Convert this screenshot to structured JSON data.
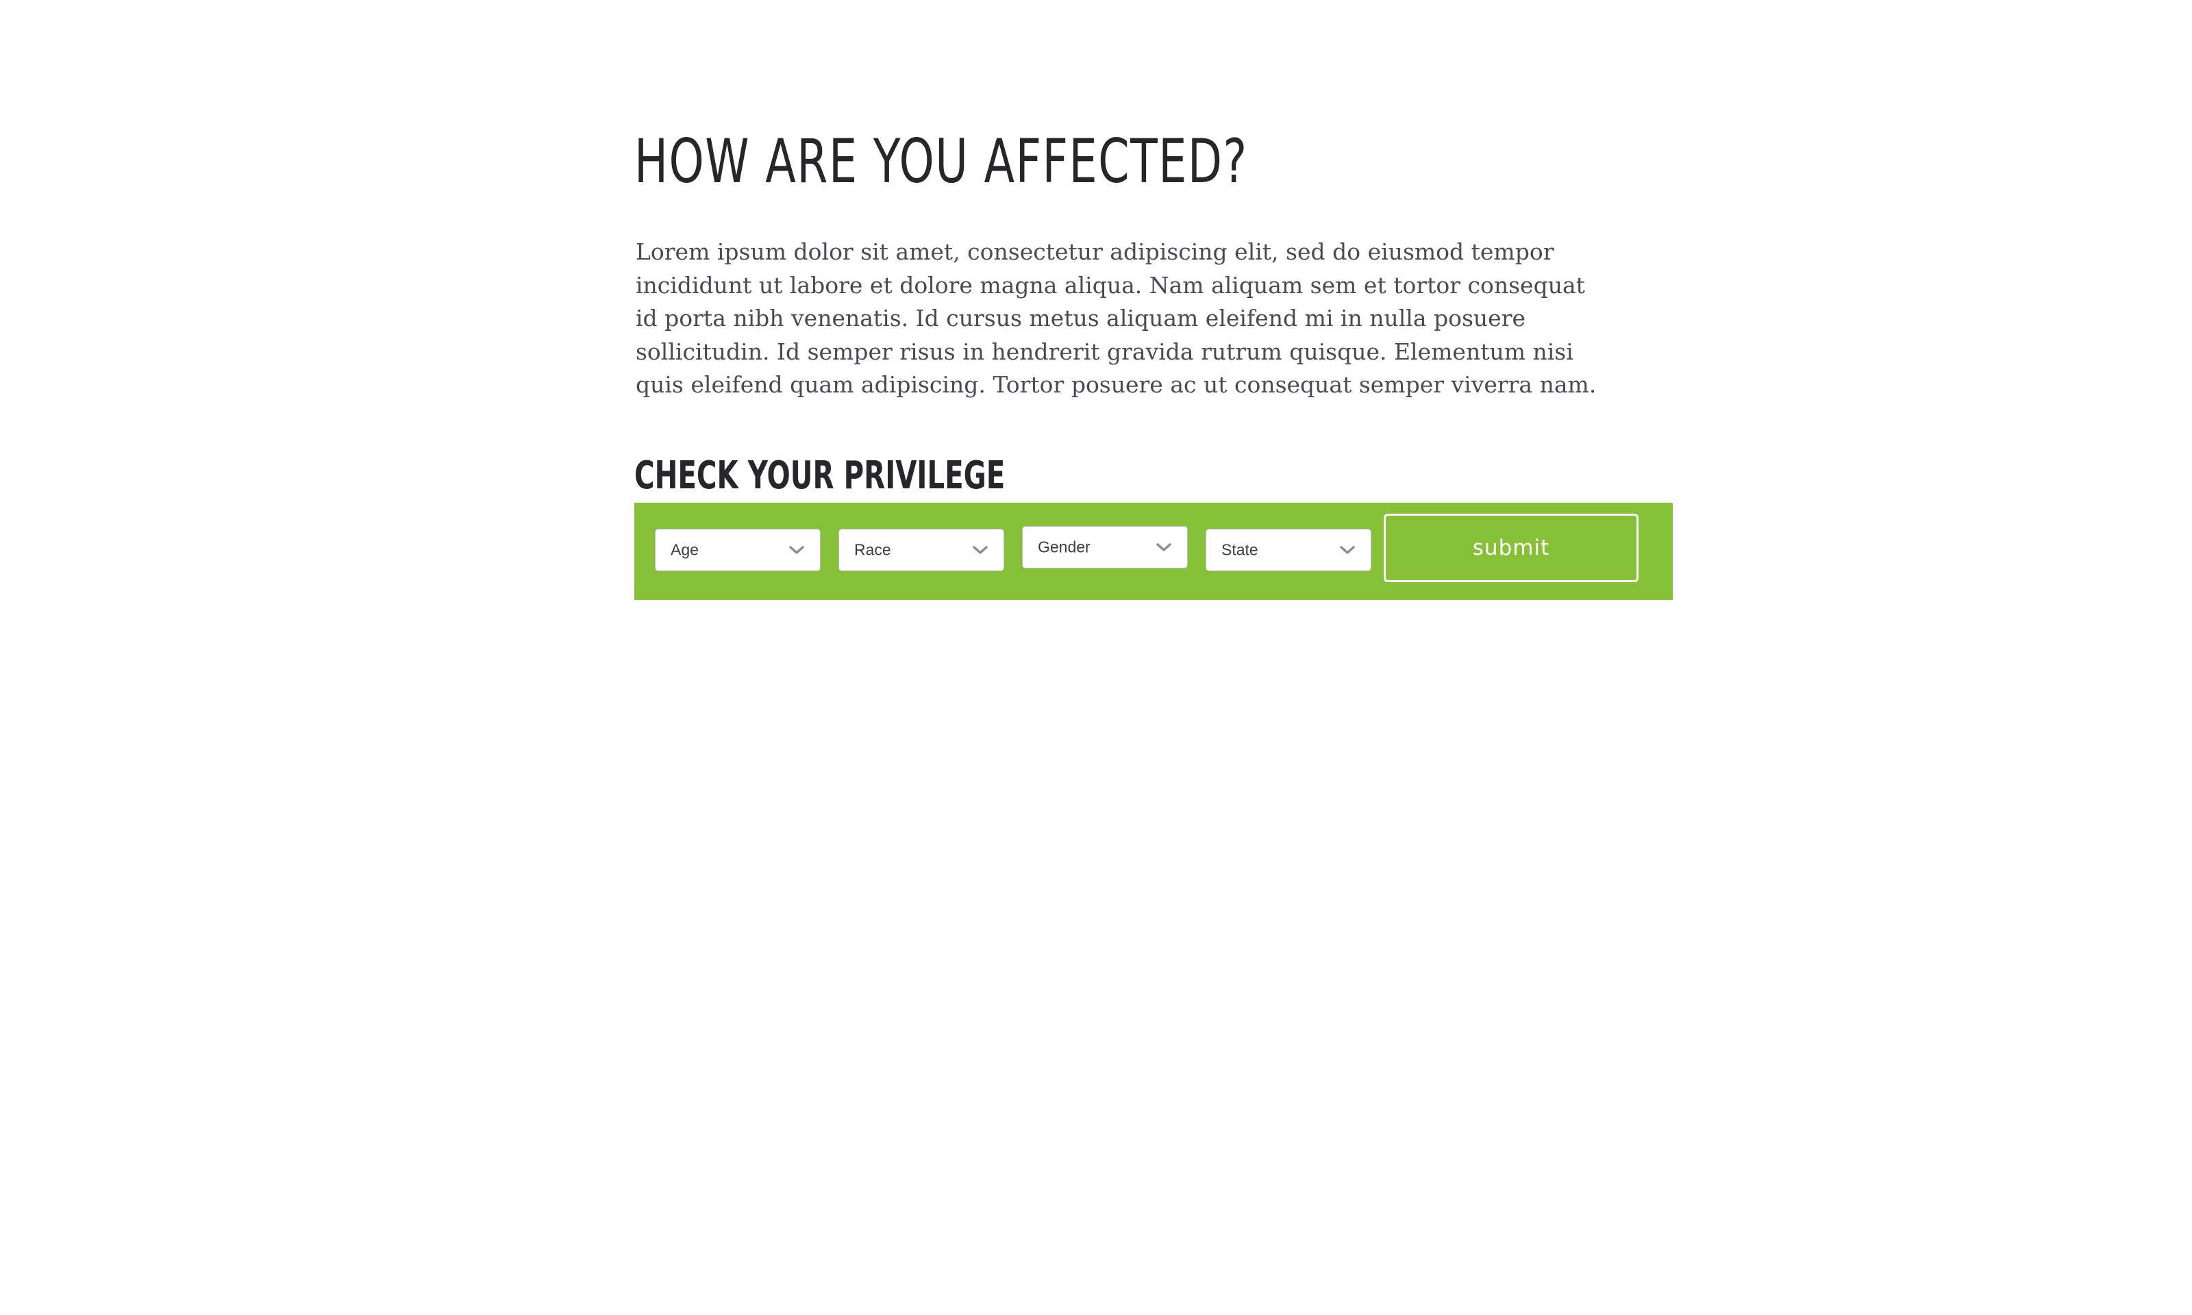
{
  "header": {
    "title": "HOW ARE YOU AFFECTED?"
  },
  "intro": {
    "text": "Lorem ipsum dolor sit amet, consectetur adipiscing elit, sed do eiusmod tempor incididunt ut labore et dolore magna aliqua. Nam aliquam sem et tortor consequat id porta nibh venenatis. Id cursus metus aliquam eleifend mi in nulla posuere sollicitudin. Id semper risus in hendrerit gravida rutrum quisque. Elementum nisi quis eleifend quam adipiscing. Tortor posuere ac ut consequat semper viverra nam."
  },
  "privilege_form": {
    "title": "CHECK YOUR PRIVILEGE",
    "selects": [
      {
        "label": "Age",
        "icon": "chevron-down-icon"
      },
      {
        "label": "Race",
        "icon": "chevron-down-icon"
      },
      {
        "label": "Gender",
        "icon": "chevron-down-icon"
      },
      {
        "label": "State",
        "icon": "chevron-down-icon"
      }
    ],
    "submit_label": "submit"
  },
  "colors": {
    "accent_green": "#86c036",
    "heading_text": "#26262b",
    "body_text": "#4a4a57",
    "background": "#ffffff"
  }
}
